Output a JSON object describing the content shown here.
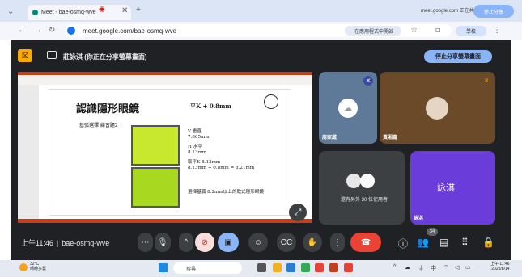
{
  "browser": {
    "tab_title": "Meet - bae-osmq-wve",
    "url": "meet.google.com/bae-osmq-wve",
    "open_in_app": "在應用程式中開啟",
    "sharing_notice": "meet.google.com 正在共用這個",
    "stop_sharing_top": "停止分享",
    "profile_label": "學校"
  },
  "meet": {
    "share_banner": "莊詠淇 (你正在分享螢幕畫面)",
    "stop_share_button": "停止分享螢幕畫面",
    "meeting_time": "上午11:46",
    "meeting_code": "bae-osmq-wve",
    "participants_badge": "34",
    "slide": {
      "title": "認識隱形眼鏡",
      "k_line": "平K + 0.8mm",
      "subtitle": "基弧選擇 練習題2",
      "lines": [
        "V 垂直",
        "7.865mm",
        "",
        "H 水平",
        "8.13mm",
        "",
        "取平K 8.13mm",
        "8.13mm + 0.8mm = 8.21mm"
      ],
      "footer": "選擇基弧 8.2mm以上的軟式隱形眼鏡"
    },
    "tiles": [
      {
        "name": "周家葳"
      },
      {
        "name": "黃湘甯"
      },
      {
        "name": "還有另外 30 位使用者"
      },
      {
        "name": "詠淇",
        "big_label": "詠淇"
      }
    ]
  },
  "taskbar": {
    "weather_temp": "32°C",
    "weather_desc": "晴時多雲",
    "search_placeholder": "搜尋",
    "clock_time": "上午 11:46",
    "clock_date": "2025/8/14"
  },
  "colors": {
    "meet_bg": "#202124",
    "accent": "#8ab4f8",
    "leave": "#ea4335",
    "present": "#8ab4f8"
  }
}
